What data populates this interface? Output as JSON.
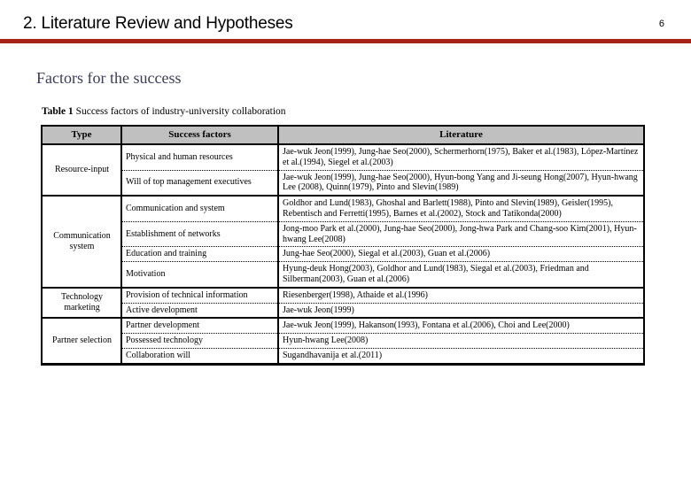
{
  "slide": {
    "title": "2. Literature Review and Hypotheses",
    "page_number": "6",
    "accent_color": "#A6231A",
    "subtitle": "Factors for the success",
    "subtitle_color": "#3b3b5c"
  },
  "table": {
    "caption_label": "Table 1",
    "caption_text": "Success factors of industry-university collaboration",
    "header_fill": "#C0C0C0",
    "columns": [
      "Type",
      "Success factors",
      "Literature"
    ],
    "groups": [
      {
        "type": "Resource-input",
        "rows": [
          {
            "factor": "Physical and human resources",
            "literature": "Jae-wuk Jeon(1999), Jung-hae Seo(2000), Schermerhorn(1975), Baker et al.(1983), López-Martínez et al.(1994), Siegel et al.(2003)"
          },
          {
            "factor": "Will of top management executives",
            "literature": "Jae-wuk Jeon(1999), Jung-hae Seo(2000), Hyun-bong Yang and Ji-seung Hong(2007), Hyun-hwang Lee (2008), Quinn(1979), Pinto and Slevin(1989)"
          }
        ]
      },
      {
        "type": "Communication system",
        "rows": [
          {
            "factor": "Communication and system",
            "literature": "Goldhor and Lund(1983), Ghoshal and Barlett(1988), Pinto and Slevin(1989), Geisler(1995), Rebentisch and Ferretti(1995), Barnes et al.(2002), Stock and Tatikonda(2000)"
          },
          {
            "factor": "Establishment of networks",
            "literature": "Jong-moo Park et al.(2000), Jung-hae Seo(2000), Jong-hwa Park and Chang-soo Kim(2001), Hyun-hwang Lee(2008)"
          },
          {
            "factor": "Education and training",
            "literature": "Jung-hae Seo(2000), Siegal et al.(2003), Guan et al.(2006)"
          },
          {
            "factor": "Motivation",
            "literature": "Hyung-deuk Hong(2003), Goldhor and Lund(1983), Siegal et al.(2003), Friedman and Silberman(2003), Guan et al.(2006)"
          }
        ]
      },
      {
        "type": "Technology marketing",
        "rows": [
          {
            "factor": "Provision of technical information",
            "literature": "Riesenberger(1998), Athaide et al.(1996)"
          },
          {
            "factor": "Active development",
            "literature": "Jae-wuk Jeon(1999)"
          }
        ]
      },
      {
        "type": "Partner selection",
        "rows": [
          {
            "factor": "Partner development",
            "literature": "Jae-wuk Jeon(1999), Hakanson(1993), Fontana et al.(2006), Choi and Lee(2000)"
          },
          {
            "factor": "Possessed technology",
            "literature": "Hyun-hwang Lee(2008)"
          },
          {
            "factor": "Collaboration will",
            "literature": "Sugandhavanija et al.(2011)"
          }
        ]
      }
    ]
  }
}
